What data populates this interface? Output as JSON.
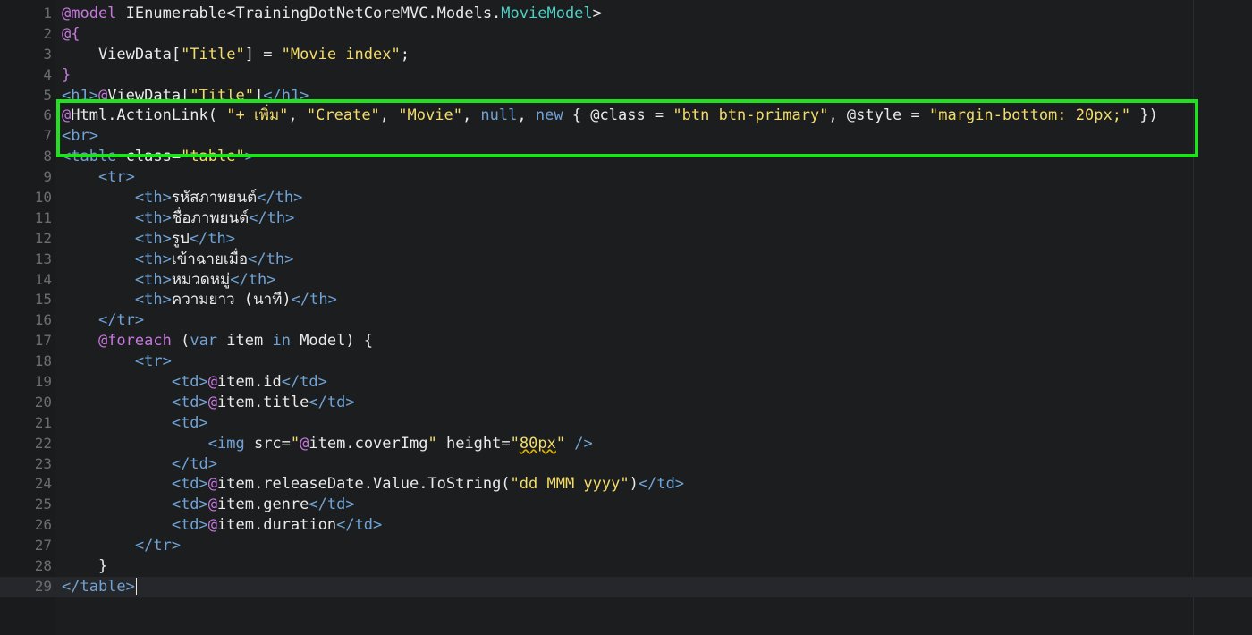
{
  "editor": {
    "active_line": 29,
    "accent_colors": {
      "highlight_box": "#20e020",
      "string": "#f2dc6b",
      "tag": "#6fa3d6",
      "razor": "#c678dd",
      "type": "#4fd1c5"
    },
    "lines": [
      {
        "n": "1",
        "parts": [
          {
            "c": "at",
            "t": "@model"
          },
          {
            "c": "t",
            "t": " IEnumerable<TrainingDotNetCoreMVC.Models."
          },
          {
            "c": "cls",
            "t": "MovieModel"
          },
          {
            "c": "t",
            "t": ">"
          }
        ]
      },
      {
        "n": "2",
        "parts": [
          {
            "c": "at",
            "t": "@{"
          }
        ]
      },
      {
        "n": "3",
        "parts": [
          {
            "c": "t",
            "t": "    ViewData["
          },
          {
            "c": "str",
            "t": "\"Title\""
          },
          {
            "c": "t",
            "t": "] = "
          },
          {
            "c": "str",
            "t": "\"Movie index\""
          },
          {
            "c": "t",
            "t": ";"
          }
        ]
      },
      {
        "n": "4",
        "parts": [
          {
            "c": "at",
            "t": "}"
          }
        ]
      },
      {
        "n": "5",
        "parts": [
          {
            "c": "tag",
            "t": "<h1>"
          },
          {
            "c": "at",
            "t": "@"
          },
          {
            "c": "t",
            "t": "ViewData["
          },
          {
            "c": "str",
            "t": "\"Title\""
          },
          {
            "c": "t",
            "t": "]"
          },
          {
            "c": "tag",
            "t": "</h1>"
          }
        ]
      },
      {
        "n": "6",
        "parts": [
          {
            "c": "at",
            "t": "@"
          },
          {
            "c": "t",
            "t": "Html.ActionLink( "
          },
          {
            "c": "str",
            "t": "\"+ เพิ่ม\""
          },
          {
            "c": "t",
            "t": ", "
          },
          {
            "c": "str",
            "t": "\"Create\""
          },
          {
            "c": "t",
            "t": ", "
          },
          {
            "c": "str",
            "t": "\"Movie\""
          },
          {
            "c": "t",
            "t": ", "
          },
          {
            "c": "kw",
            "t": "null"
          },
          {
            "c": "t",
            "t": ", "
          },
          {
            "c": "kw",
            "t": "new"
          },
          {
            "c": "t",
            "t": " { @class = "
          },
          {
            "c": "str",
            "t": "\"btn btn-primary\""
          },
          {
            "c": "t",
            "t": ", @style = "
          },
          {
            "c": "str",
            "t": "\"margin-bottom: 20px;\""
          },
          {
            "c": "t",
            "t": " })"
          }
        ]
      },
      {
        "n": "7",
        "parts": [
          {
            "c": "tag",
            "t": "<br>"
          }
        ]
      },
      {
        "n": "8",
        "parts": [
          {
            "c": "tag",
            "t": "<table"
          },
          {
            "c": "attr",
            "t": " class="
          },
          {
            "c": "str",
            "t": "\"table\""
          },
          {
            "c": "tag",
            "t": ">"
          }
        ]
      },
      {
        "n": "9",
        "parts": [
          {
            "c": "t",
            "t": "    "
          },
          {
            "c": "tag",
            "t": "<tr>"
          }
        ]
      },
      {
        "n": "10",
        "parts": [
          {
            "c": "t",
            "t": "        "
          },
          {
            "c": "tag",
            "t": "<th>"
          },
          {
            "c": "t",
            "t": "รหัสภาพยนต์"
          },
          {
            "c": "tag",
            "t": "</th>"
          }
        ]
      },
      {
        "n": "11",
        "parts": [
          {
            "c": "t",
            "t": "        "
          },
          {
            "c": "tag",
            "t": "<th>"
          },
          {
            "c": "t",
            "t": "ชื่อภาพยนต์"
          },
          {
            "c": "tag",
            "t": "</th>"
          }
        ]
      },
      {
        "n": "12",
        "parts": [
          {
            "c": "t",
            "t": "        "
          },
          {
            "c": "tag",
            "t": "<th>"
          },
          {
            "c": "t",
            "t": "รูป"
          },
          {
            "c": "tag",
            "t": "</th>"
          }
        ]
      },
      {
        "n": "13",
        "parts": [
          {
            "c": "t",
            "t": "        "
          },
          {
            "c": "tag",
            "t": "<th>"
          },
          {
            "c": "t",
            "t": "เข้าฉายเมื่อ"
          },
          {
            "c": "tag",
            "t": "</th>"
          }
        ]
      },
      {
        "n": "14",
        "parts": [
          {
            "c": "t",
            "t": "        "
          },
          {
            "c": "tag",
            "t": "<th>"
          },
          {
            "c": "t",
            "t": "หมวดหมู่"
          },
          {
            "c": "tag",
            "t": "</th>"
          }
        ]
      },
      {
        "n": "15",
        "parts": [
          {
            "c": "t",
            "t": "        "
          },
          {
            "c": "tag",
            "t": "<th>"
          },
          {
            "c": "t",
            "t": "ความยาว (นาที)"
          },
          {
            "c": "tag",
            "t": "</th>"
          }
        ]
      },
      {
        "n": "16",
        "parts": [
          {
            "c": "t",
            "t": "    "
          },
          {
            "c": "tag",
            "t": "</tr>"
          }
        ]
      },
      {
        "n": "17",
        "parts": [
          {
            "c": "t",
            "t": "    "
          },
          {
            "c": "at",
            "t": "@foreach"
          },
          {
            "c": "t",
            "t": " ("
          },
          {
            "c": "kw",
            "t": "var"
          },
          {
            "c": "t",
            "t": " item "
          },
          {
            "c": "kw",
            "t": "in"
          },
          {
            "c": "t",
            "t": " Model) {"
          }
        ]
      },
      {
        "n": "18",
        "parts": [
          {
            "c": "t",
            "t": "        "
          },
          {
            "c": "tag",
            "t": "<tr>"
          }
        ]
      },
      {
        "n": "19",
        "parts": [
          {
            "c": "t",
            "t": "            "
          },
          {
            "c": "tag",
            "t": "<td>"
          },
          {
            "c": "at",
            "t": "@"
          },
          {
            "c": "t",
            "t": "item.id"
          },
          {
            "c": "tag",
            "t": "</td>"
          }
        ]
      },
      {
        "n": "20",
        "parts": [
          {
            "c": "t",
            "t": "            "
          },
          {
            "c": "tag",
            "t": "<td>"
          },
          {
            "c": "at",
            "t": "@"
          },
          {
            "c": "t",
            "t": "item.title"
          },
          {
            "c": "tag",
            "t": "</td>"
          }
        ]
      },
      {
        "n": "21",
        "parts": [
          {
            "c": "t",
            "t": "            "
          },
          {
            "c": "tag",
            "t": "<td>"
          }
        ]
      },
      {
        "n": "22",
        "parts": [
          {
            "c": "t",
            "t": "                "
          },
          {
            "c": "tag",
            "t": "<img"
          },
          {
            "c": "attr",
            "t": " src="
          },
          {
            "c": "str",
            "t": "\""
          },
          {
            "c": "at",
            "t": "@"
          },
          {
            "c": "t",
            "t": "item.coverImg"
          },
          {
            "c": "str",
            "t": "\""
          },
          {
            "c": "attr",
            "t": " height="
          },
          {
            "c": "str",
            "t": "\""
          },
          {
            "c": "str wavy",
            "t": "80px"
          },
          {
            "c": "str",
            "t": "\""
          },
          {
            "c": "tag",
            "t": " />"
          }
        ]
      },
      {
        "n": "23",
        "parts": [
          {
            "c": "t",
            "t": "            "
          },
          {
            "c": "tag",
            "t": "</td>"
          }
        ]
      },
      {
        "n": "24",
        "parts": [
          {
            "c": "t",
            "t": "            "
          },
          {
            "c": "tag",
            "t": "<td>"
          },
          {
            "c": "at",
            "t": "@"
          },
          {
            "c": "t",
            "t": "item.releaseDate.Value.ToString("
          },
          {
            "c": "str",
            "t": "\"dd MMM yyyy\""
          },
          {
            "c": "t",
            "t": ")"
          },
          {
            "c": "tag",
            "t": "</td>"
          }
        ]
      },
      {
        "n": "25",
        "parts": [
          {
            "c": "t",
            "t": "            "
          },
          {
            "c": "tag",
            "t": "<td>"
          },
          {
            "c": "at",
            "t": "@"
          },
          {
            "c": "t",
            "t": "item.genre"
          },
          {
            "c": "tag",
            "t": "</td>"
          }
        ]
      },
      {
        "n": "26",
        "parts": [
          {
            "c": "t",
            "t": "            "
          },
          {
            "c": "tag",
            "t": "<td>"
          },
          {
            "c": "at",
            "t": "@"
          },
          {
            "c": "t",
            "t": "item.duration"
          },
          {
            "c": "tag",
            "t": "</td>"
          }
        ]
      },
      {
        "n": "27",
        "parts": [
          {
            "c": "t",
            "t": "        "
          },
          {
            "c": "tag",
            "t": "</tr>"
          }
        ]
      },
      {
        "n": "28",
        "parts": [
          {
            "c": "t",
            "t": "    }"
          }
        ]
      },
      {
        "n": "29",
        "parts": [
          {
            "c": "tag",
            "t": "</table>"
          }
        ]
      }
    ]
  }
}
